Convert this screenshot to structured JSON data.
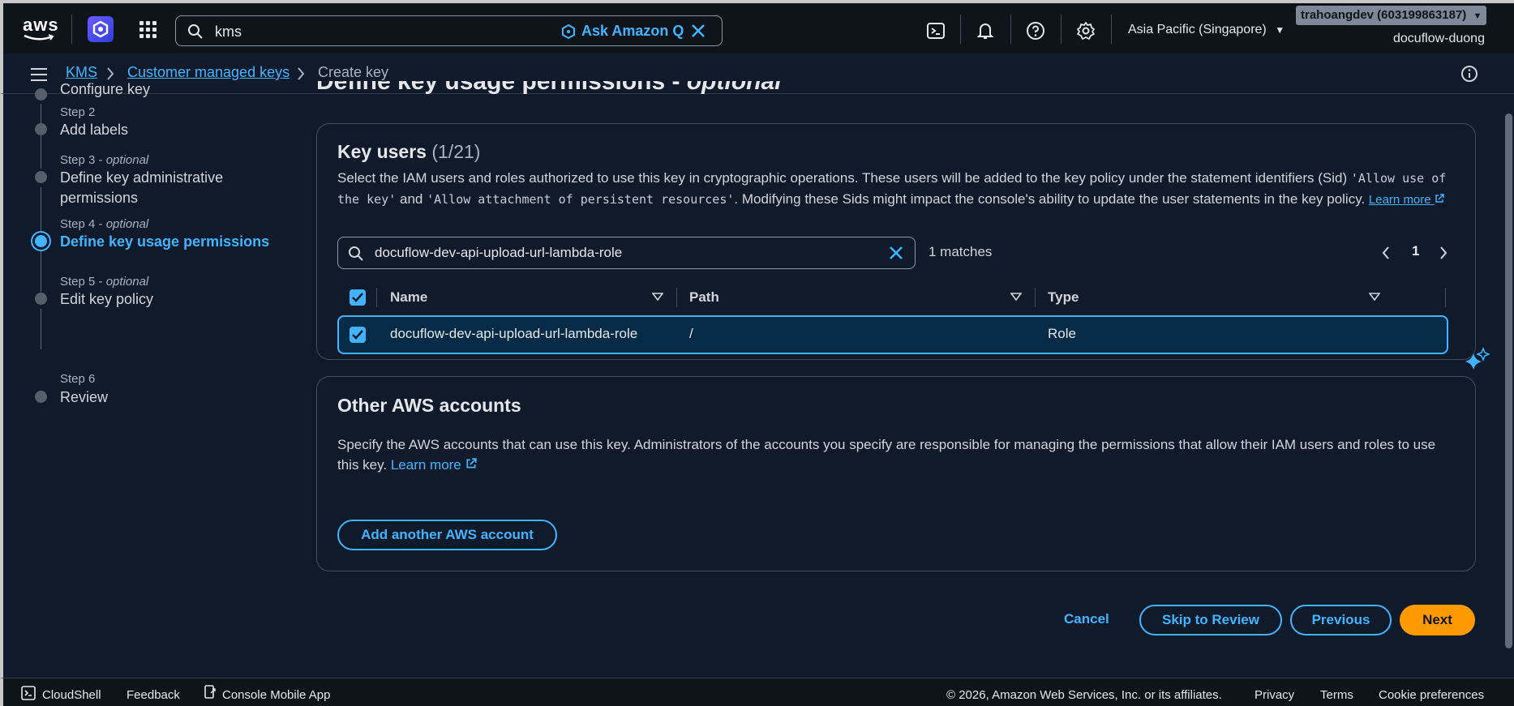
{
  "topnav": {
    "logo_text": "aws",
    "search_value": "kms",
    "ask_q": "Ask Amazon Q",
    "region": "Asia Pacific (Singapore)",
    "account": "trahoangdev (603199863187)",
    "account_sub": "docuflow-duong"
  },
  "breadcrumb": {
    "items": [
      "KMS",
      "Customer managed keys",
      "Create key"
    ]
  },
  "steps": [
    {
      "label": "",
      "title": "Configure key"
    },
    {
      "label": "Step 2",
      "title": "Add labels"
    },
    {
      "label": "Step 3",
      "optional": "optional",
      "title": "Define key administrative permissions"
    },
    {
      "label": "Step 4",
      "optional": "optional",
      "title": "Define key usage permissions"
    },
    {
      "label": "Step 5",
      "optional": "optional",
      "title": "Edit key policy"
    },
    {
      "label": "Step 6",
      "title": "Review"
    }
  ],
  "page_heading": "Define key usage permissions",
  "page_heading_optional": "optional",
  "key_users": {
    "title": "Key users",
    "count": "(1/21)",
    "desc_1": "Select the IAM users and roles authorized to use this key in cryptographic operations. These users will be added to the key policy under the statement identifiers (Sid)",
    "sid_1": "'Allow use of the key'",
    "and": "and",
    "sid_2": "'Allow attachment of persistent resources'",
    "desc_2": ". Modifying these Sids might impact the console's ability to update the user statements in the key policy.",
    "learn_more": "Learn more",
    "filter_value": "docuflow-dev-api-upload-url-lambda-role",
    "matches": "1 matches",
    "page": "1",
    "columns": [
      "Name",
      "Path",
      "Type"
    ],
    "rows": [
      {
        "name": "docuflow-dev-api-upload-url-lambda-role",
        "path": "/",
        "type": "Role"
      }
    ]
  },
  "other_accounts": {
    "title": "Other AWS accounts",
    "desc": "Specify the AWS accounts that can use this key. Administrators of the accounts you specify are responsible for managing the permissions that allow their IAM users and roles to use this key.",
    "learn_more": "Learn more",
    "add_button": "Add another AWS account"
  },
  "actions": {
    "cancel": "Cancel",
    "skip": "Skip to Review",
    "previous": "Previous",
    "next": "Next"
  },
  "footer": {
    "cloudshell": "CloudShell",
    "feedback": "Feedback",
    "mobile": "Console Mobile App",
    "copyright": "© 2026, Amazon Web Services, Inc. or its affiliates.",
    "privacy": "Privacy",
    "terms": "Terms",
    "cookies": "Cookie preferences"
  },
  "colors": {
    "accent": "#42b4ff",
    "primary": "#ff9900",
    "bg": "#0f1b2a"
  }
}
